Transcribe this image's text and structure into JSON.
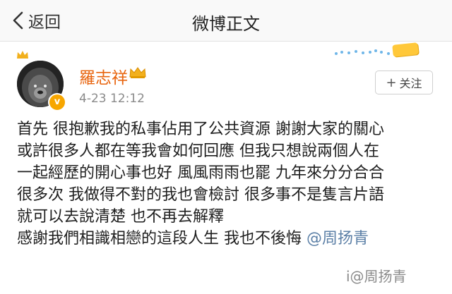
{
  "header": {
    "back_label": "返回",
    "title": "微博正文"
  },
  "user": {
    "name": "羅志祥",
    "timestamp": "4-23 12:12",
    "verified_mark": "v"
  },
  "follow": {
    "plus": "+",
    "label": "关注"
  },
  "post": {
    "lines": [
      "首先 很抱歉我的私事佔用了公共資源 謝謝大家的關心",
      "或許很多人都在等我會如何回應 但我只想說兩個人在",
      "一起經歷的開心事也好 風風雨雨也罷 九年來分分合合",
      "很多次 我做得不對的我也會檢討 很多事不是隻言片語",
      "就可以去說清楚 也不再去解釋"
    ],
    "last_line_text": "感謝我們相識相戀的這段人生 我也不後悔 ",
    "mention": "@周扬青"
  },
  "watermark": "i@周扬青",
  "colors": {
    "username": "#e8650f",
    "mention": "#5b7fa6",
    "verified": "#f7a600",
    "crown": "#f2b01c"
  }
}
